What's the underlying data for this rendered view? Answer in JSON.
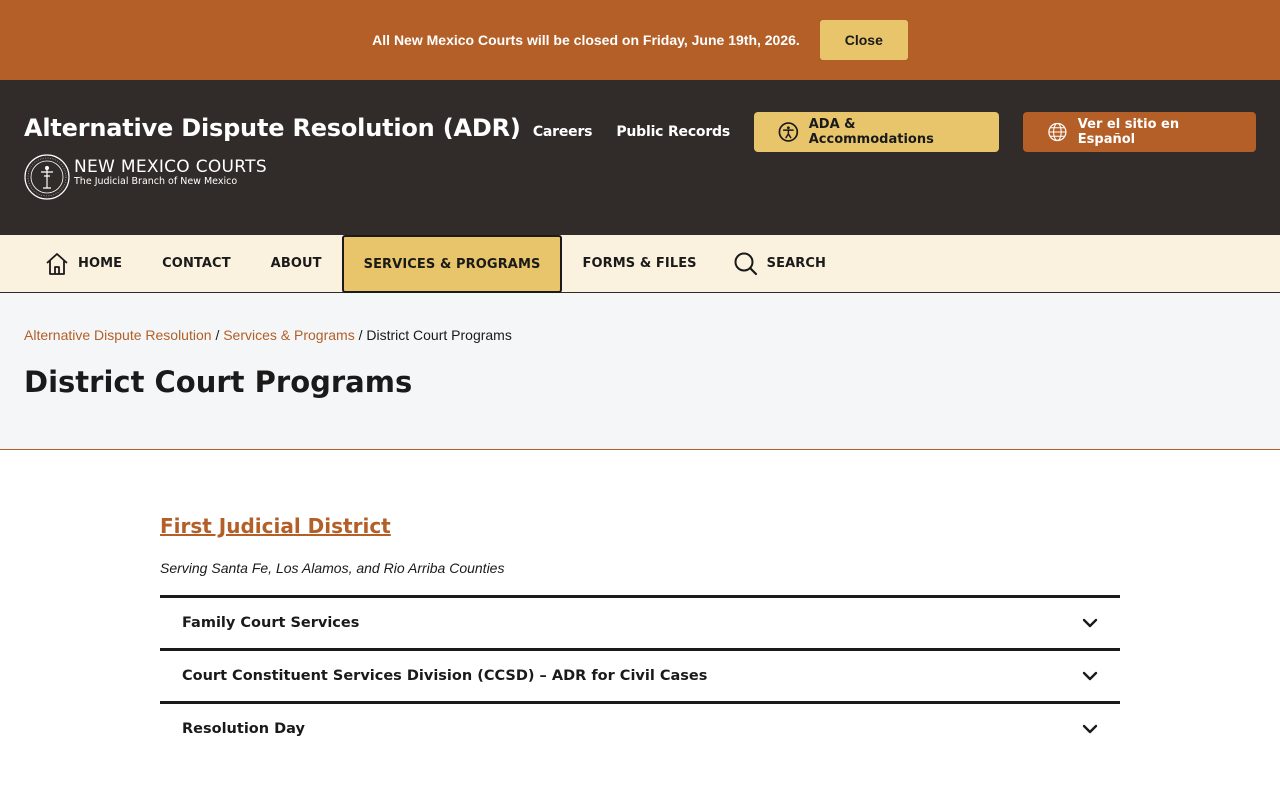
{
  "alert": {
    "message": "All New Mexico Courts will be closed on Friday, June 19th, 2026.",
    "close_label": "Close"
  },
  "header": {
    "site_title": "Alternative Dispute Resolution (ADR)",
    "logo_main": "NEW MEXICO COURTS",
    "logo_sub": "The Judicial Branch of New Mexico",
    "links": [
      "Careers",
      "Public Records"
    ],
    "ada_label": "ADA & Accommodations",
    "spanish_label": "Ver el sitio en Español"
  },
  "nav": {
    "home": "HOME",
    "contact": "CONTACT",
    "about": "ABOUT",
    "services": "SERVICES & PROGRAMS",
    "forms": "FORMS & FILES",
    "search": "SEARCH"
  },
  "breadcrumb": {
    "items": [
      "Alternative Dispute Resolution",
      "Services & Programs"
    ],
    "current": "District Court Programs"
  },
  "page_title": "District Court Programs",
  "district": {
    "title": "First Judicial District",
    "subtitle": "Serving Santa Fe, Los Alamos, and Rio Arriba Counties",
    "programs": [
      "Family Court Services",
      "Court Constituent Services Division (CCSD) – ADR for Civil Cases",
      "Resolution Day"
    ]
  },
  "colors": {
    "accent": "#b35f27",
    "gold": "#e8c56b",
    "header_bg": "#312c29",
    "nav_bg": "#faf1de"
  }
}
